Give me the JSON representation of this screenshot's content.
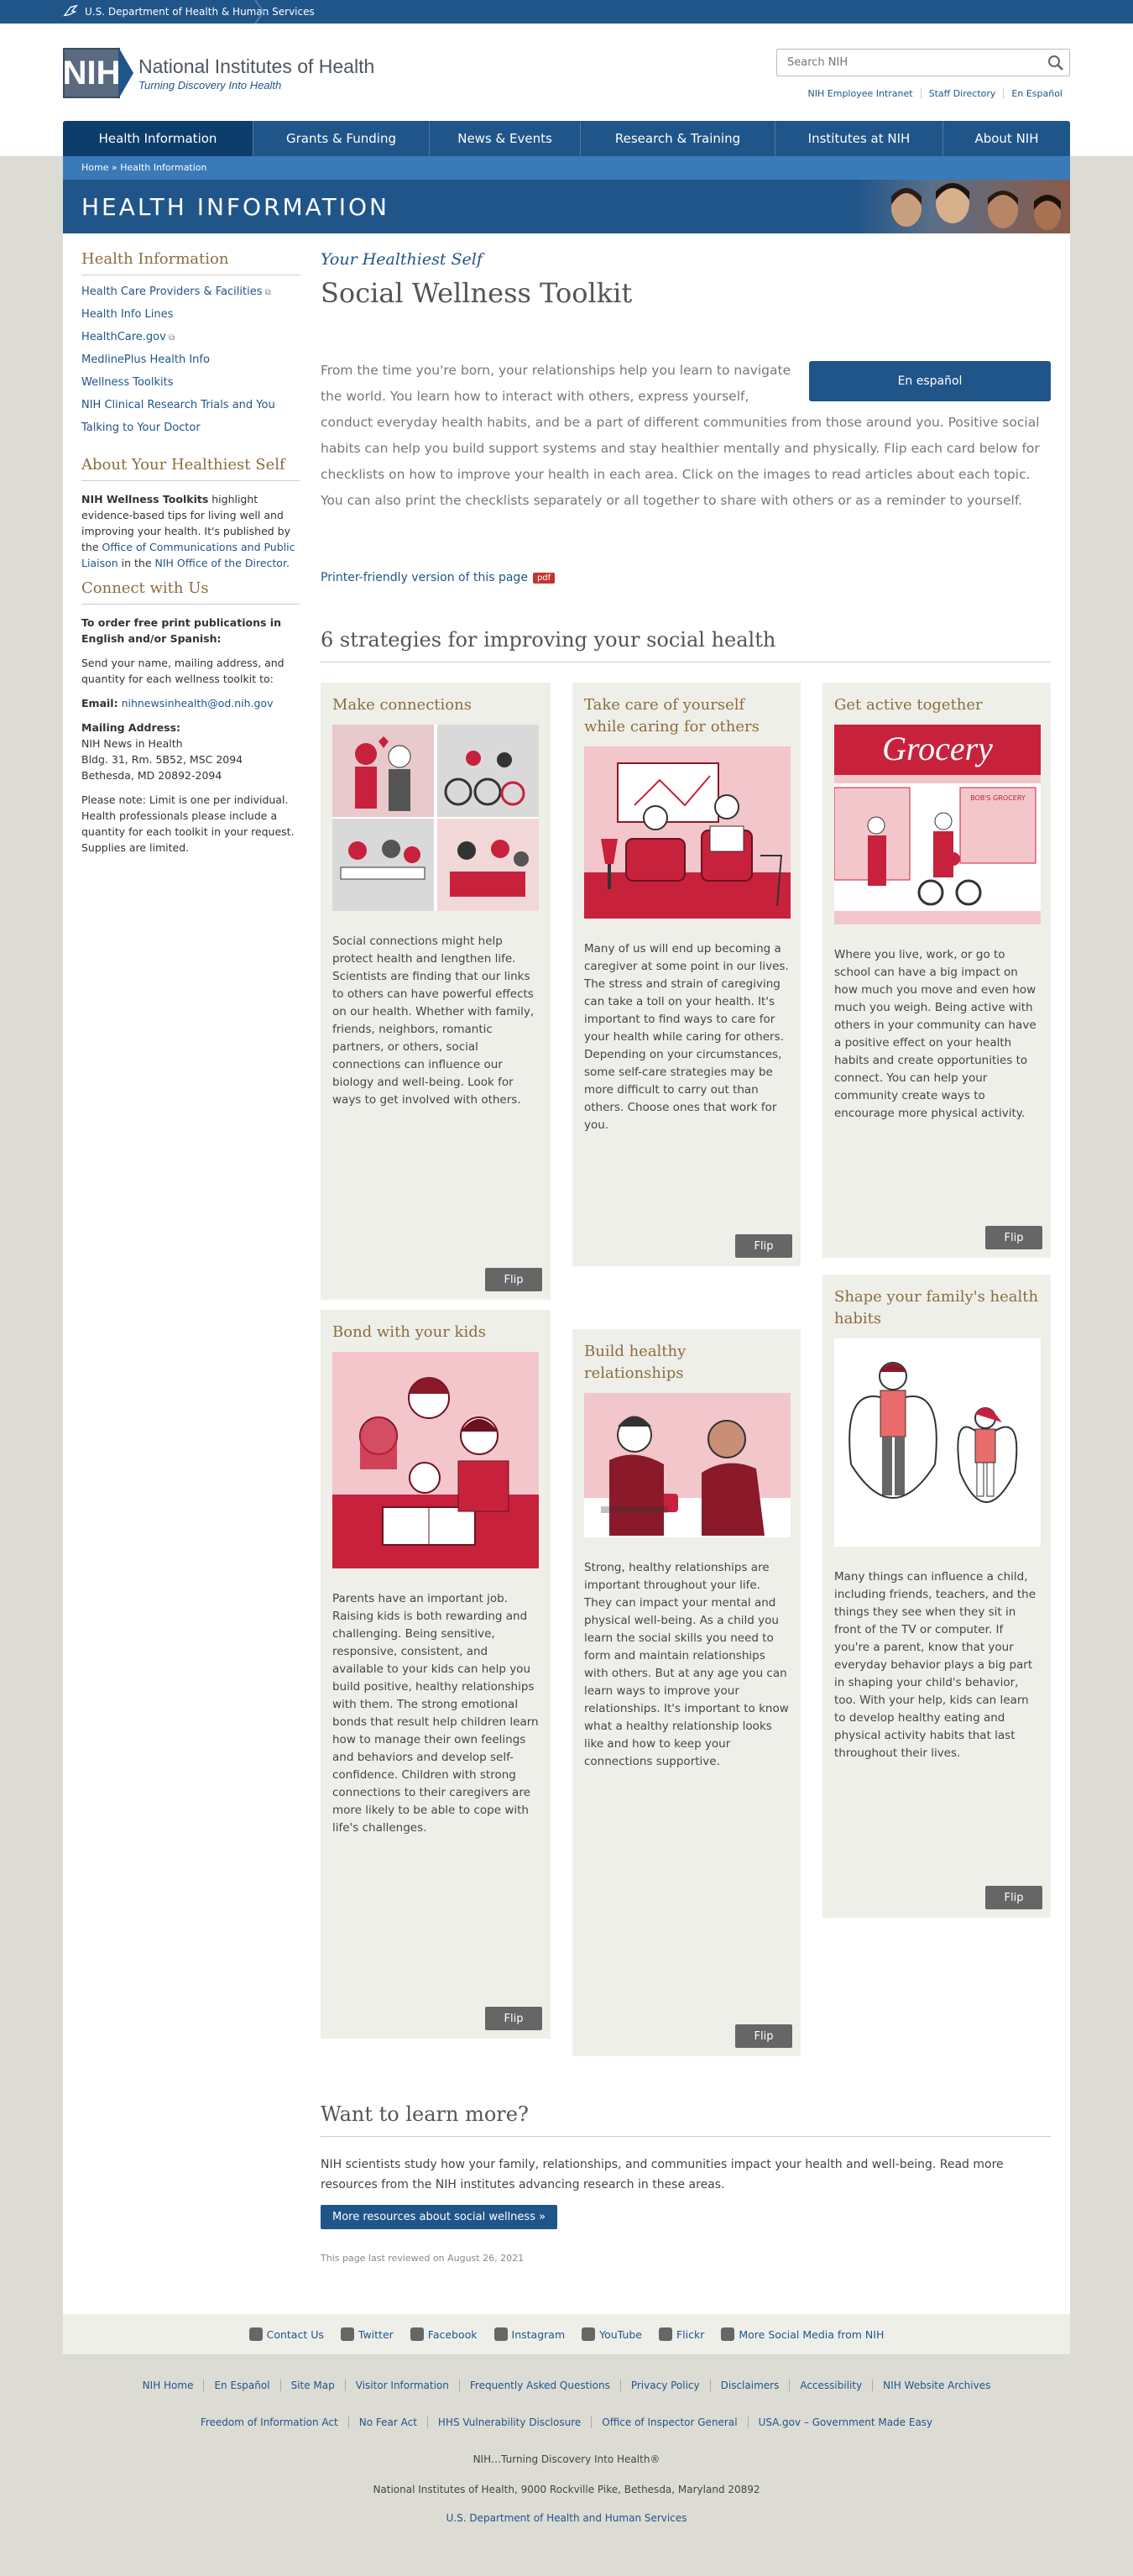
{
  "hhs": {
    "label": "U.S. Department of Health & Human Services"
  },
  "logo": {
    "abbr": "NIH",
    "name": "National Institutes of Health",
    "tagline": "Turning Discovery Into Health"
  },
  "search": {
    "placeholder": "Search NIH"
  },
  "header_links": [
    "NIH Employee Intranet",
    "Staff Directory",
    "En Español"
  ],
  "nav": [
    "Health Information",
    "Grants & Funding",
    "News & Events",
    "Research & Training",
    "Institutes at NIH",
    "About NIH"
  ],
  "breadcrumb": "Home » Health Information",
  "banner": "HEALTH INFORMATION",
  "sidebar": {
    "h1": "Health Information",
    "links": [
      "Health Care Providers & Facilities",
      "Health Info Lines",
      "HealthCare.gov",
      "MedlinePlus Health Info",
      "Wellness Toolkits",
      "NIH Clinical Research Trials and You",
      "Talking to Your Doctor"
    ],
    "h2": "About Your Healthiest Self",
    "about_bold": "NIH Wellness Toolkits",
    "about_1": " highlight evidence-based tips for living well and improving your health. It's published by the ",
    "about_link1": "Office of Communications and Public Liaison",
    "about_2": " in the ",
    "about_link2": "NIH Office of the Director",
    "about_3": ".",
    "h3": "Connect with Us",
    "order_bold": "To order free print publications in English and/or Spanish:",
    "order_text": "Send your name, mailing address, and quantity for each wellness toolkit to:",
    "email_label": "Email:",
    "email": "nihnewsinhealth@od.nih.gov",
    "mail_label": "Mailing Address:",
    "mail_lines": [
      "NIH News in Health",
      "Bldg. 31, Rm. 5B52, MSC 2094",
      "Bethesda, MD 20892-2094"
    ],
    "note": "Please note: Limit is one per individual. Health professionals please include a quantity for each toolkit in your request. Supplies are limited."
  },
  "content": {
    "kicker": "Your Healthiest Self",
    "title": "Social Wellness Toolkit",
    "espanol": "En español",
    "intro": "From the time you're born, your relationships help you learn to navigate the world. You learn how to interact with others, express yourself, conduct everyday health habits, and be a part of different communities from those around you. Positive social habits can help you build support systems and stay healthier mentally and physically. Flip each card below for checklists on how to improve your health in each area. Click on the images to read articles about each topic. You can also print the checklists separately or all together to share with others or as a reminder to yourself.",
    "printer": "Printer-friendly version of this page",
    "pdf": "pdf",
    "strategies_heading": "6 strategies for improving your social health",
    "flip": "Flip",
    "cards": [
      {
        "title": "Make connections",
        "text": "Social connections might help protect health and lengthen life. Scientists are finding that our links to others can have powerful effects on our health. Whether with family, friends, neighbors, romantic partners, or others, social connections can influence our biology and well-being. Look for ways to get involved with others."
      },
      {
        "title": "Take care of yourself while caring for others",
        "text": "Many of us will end up becoming a caregiver at some point in our lives. The stress and strain of caregiving can take a toll on your health. It's important to find ways to care for your health while caring for others. Depending on your circumstances, some self-care strategies may be more difficult to carry out than others. Choose ones that work for you."
      },
      {
        "title": "Get active together",
        "sign": "Grocery",
        "sign2": "BOB'S GROCERY",
        "text": "Where you live, work, or go to school can have a big impact on how much you move and even how much you weigh. Being active with others in your community can have a positive effect on your health habits and create opportunities to connect. You can help your community create ways to encourage more physical activity."
      },
      {
        "title": "Bond with your kids",
        "text": "Parents have an important job. Raising kids is both rewarding and challenging. Being sensitive, responsive, consistent, and available to your kids can help you build positive, healthy relationships with them. The strong emotional bonds that result help children learn how to manage their own feelings and behaviors and develop self-confidence. Children with strong connections to their caregivers are more likely to be able to cope with life's challenges."
      },
      {
        "title": "Build healthy relationships",
        "text": "Strong, healthy relationships are important throughout your life. They can impact your mental and physical well-being. As a child you learn the social skills you need to form and maintain relationships with others. But at any age you can learn ways to improve your relationships. It's important to know what a healthy relationship looks like and how to keep your connections supportive."
      },
      {
        "title": "Shape your family's health habits",
        "text": "Many things can influence a child, including friends, teachers, and the things they see when they sit in front of the TV or computer. If you're a parent, know that your everyday behavior plays a big part in shaping your child's behavior, too. With your help, kids can learn to develop healthy eating and physical activity habits that last throughout their lives."
      }
    ],
    "more_heading": "Want to learn more?",
    "more_text": "NIH scientists study how your family, relationships, and communities impact your health and well-being. Read more resources from the NIH institutes advancing research in these areas.",
    "more_button": "More resources about social wellness »",
    "reviewed": "This page last reviewed on August 26, 2021"
  },
  "social": [
    "Contact Us",
    "Twitter",
    "Facebook",
    "Instagram",
    "YouTube",
    "Flickr",
    "More Social Media from NIH"
  ],
  "footer1": [
    "NIH Home",
    "En Español",
    "Site Map",
    "Visitor Information",
    "Frequently Asked Questions",
    "Privacy Policy",
    "Disclaimers",
    "Accessibility",
    "NIH Website Archives"
  ],
  "footer2": [
    "Freedom of Information Act",
    "No Fear Act",
    "HHS Vulnerability Disclosure",
    "Office of Inspector General",
    "USA.gov – Government Made Easy"
  ],
  "footer3": "NIH…Turning Discovery Into Health®",
  "footer4": "National Institutes of Health, 9000 Rockville Pike, Bethesda, Maryland 20892",
  "footer5": "U.S. Department of Health and Human Services",
  "colors": {
    "nih_blue": "#20558a",
    "accent_red": "#c8213c",
    "gold": "#8a6d3e"
  }
}
